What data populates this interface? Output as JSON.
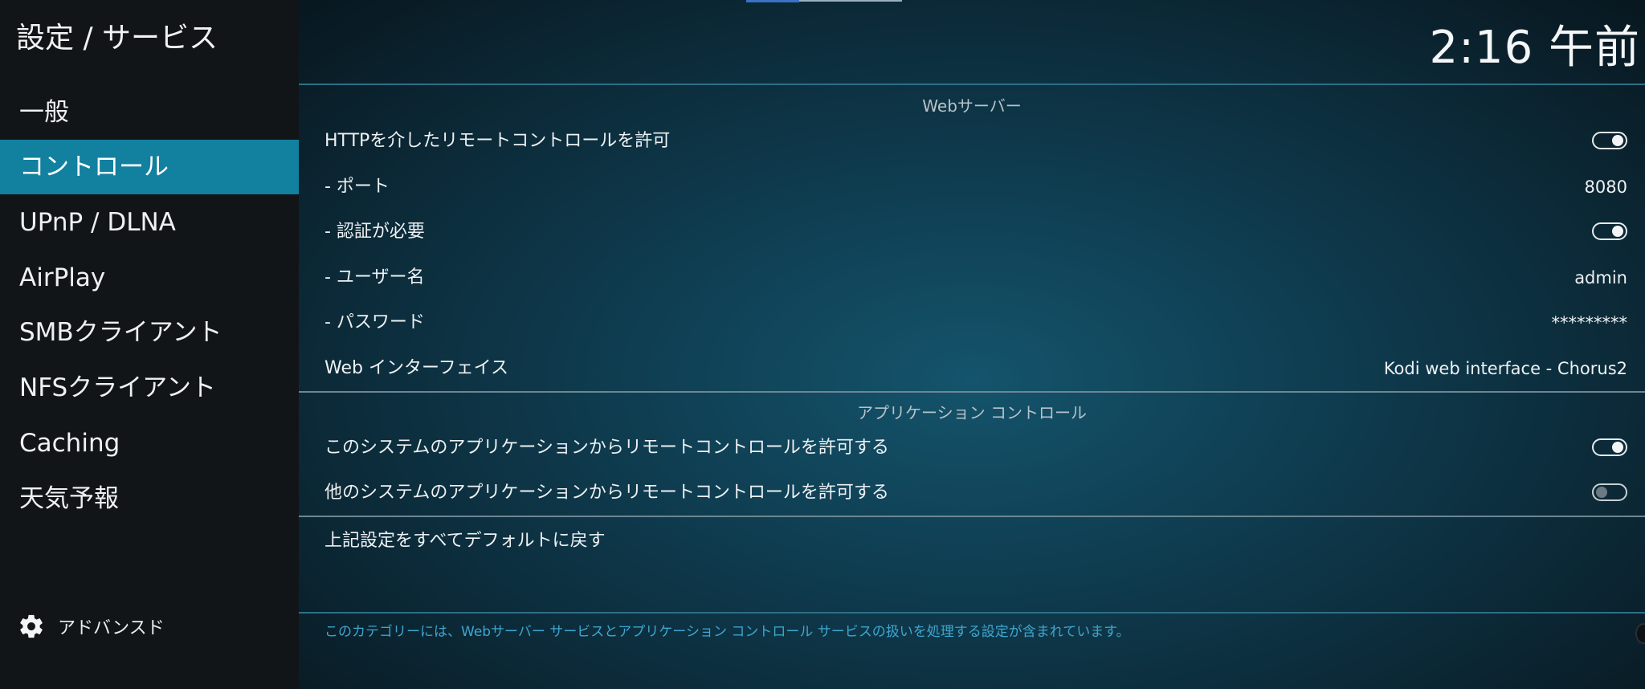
{
  "breadcrumb": "設定 / サービス",
  "clock": "2:16 午前",
  "sidebar": {
    "items": [
      {
        "label": "一般"
      },
      {
        "label": "コントロール"
      },
      {
        "label": "UPnP / DLNA"
      },
      {
        "label": "AirPlay"
      },
      {
        "label": "SMBクライアント"
      },
      {
        "label": "NFSクライアント"
      },
      {
        "label": "Caching"
      },
      {
        "label": "天気予報"
      }
    ],
    "active_index": 1,
    "advanced_label": "アドバンスド",
    "advanced_icon": "gear-icon"
  },
  "sections": {
    "webserver": {
      "title": "Webサーバー",
      "rows": {
        "allow_http": {
          "label": "HTTPを介したリモートコントロールを許可",
          "toggle": "on"
        },
        "port": {
          "label": "- ポート",
          "value": "8080"
        },
        "auth": {
          "label": "- 認証が必要",
          "toggle": "on"
        },
        "username": {
          "label": "- ユーザー名",
          "value": "admin"
        },
        "password": {
          "label": "- パスワード",
          "value": "*********"
        },
        "web_interface": {
          "label": "Web インターフェイス",
          "value": "Kodi web interface - Chorus2"
        }
      }
    },
    "app_control": {
      "title": "アプリケーション コントロール",
      "rows": {
        "this_system": {
          "label": "このシステムのアプリケーションからリモートコントロールを許可する",
          "toggle": "on"
        },
        "other_systems": {
          "label": "他のシステムのアプリケーションからリモートコントロールを許可する",
          "toggle": "off"
        }
      }
    },
    "reset": {
      "label": "上記設定をすべてデフォルトに戻す"
    }
  },
  "description": "このカテゴリーには、Webサーバー サービスとアプリケーション コントロール サービスの扱いを処理する設定が含まれています。",
  "colors": {
    "accent": "#12809f",
    "sidebar_bg": "#121518",
    "footer_text": "#3ea6d0"
  }
}
